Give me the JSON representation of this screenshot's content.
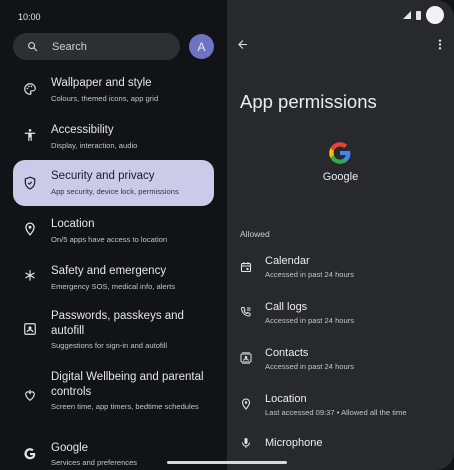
{
  "status_bar": {
    "time": "10:00"
  },
  "search": {
    "label": "Search"
  },
  "account": {
    "initial": "A"
  },
  "settings": [
    {
      "title": "Wallpaper and style",
      "subtitle": "Colours, themed icons, app grid",
      "icon": "palette-icon"
    },
    {
      "title": "Accessibility",
      "subtitle": "Display, interaction, audio",
      "icon": "accessibility-icon"
    },
    {
      "title": "Security and privacy",
      "subtitle": "App security, device lock, permissions",
      "icon": "shield-icon",
      "selected": true
    },
    {
      "title": "Location",
      "subtitle": "On/5 apps have access to location",
      "icon": "location-pin-icon"
    },
    {
      "title": "Safety and emergency",
      "subtitle": "Emergency SOS, medical info, alerts",
      "icon": "asterisk-icon"
    },
    {
      "title": "Passwords, passkeys and autofill",
      "subtitle": "Suggestions for sign-in and autofill",
      "icon": "person-badge-icon"
    },
    {
      "title": "Digital Wellbeing and parental controls",
      "subtitle": "Screen time, app timers, bedtime schedules",
      "icon": "wellbeing-icon"
    },
    {
      "title": "Google",
      "subtitle": "Services and preferences",
      "icon": "google-g-icon"
    }
  ],
  "detail": {
    "title": "App permissions",
    "app_name": "Google",
    "section_header": "Allowed",
    "permissions": [
      {
        "title": "Calendar",
        "subtitle": "Accessed in past 24 hours",
        "icon": "calendar-icon"
      },
      {
        "title": "Call logs",
        "subtitle": "Accessed in past 24 hours",
        "icon": "call-log-icon"
      },
      {
        "title": "Contacts",
        "subtitle": "Accessed in past 24 hours",
        "icon": "contacts-icon"
      },
      {
        "title": "Location",
        "subtitle": "Last accessed 09:37 • Allowed all the time",
        "icon": "location-pin-icon"
      },
      {
        "title": "Microphone",
        "subtitle": "",
        "icon": "microphone-icon"
      }
    ]
  },
  "colors": {
    "left_background": "#121316",
    "right_background": "#28292d",
    "selected_item": "#cdc9e8",
    "avatar": "#6f74c2"
  }
}
